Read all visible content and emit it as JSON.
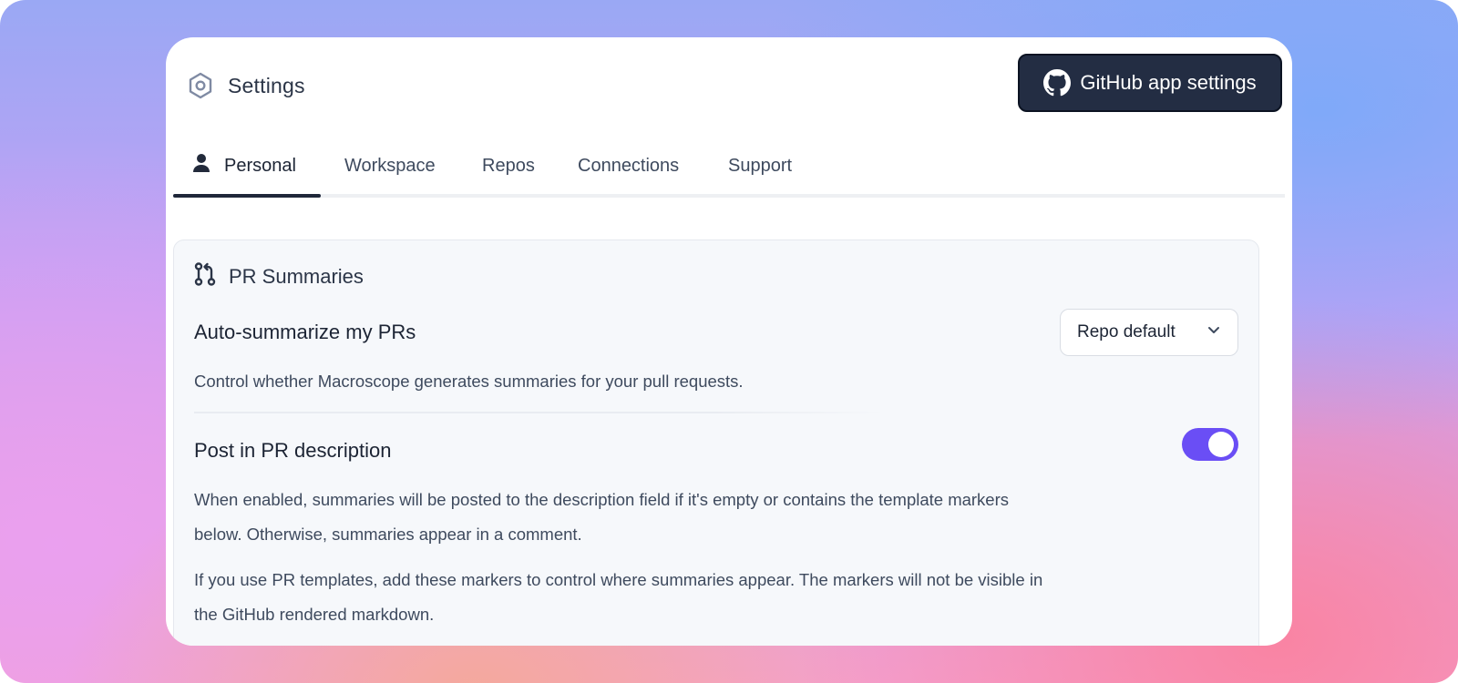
{
  "header": {
    "title": "Settings",
    "github_button_label": "GitHub app settings"
  },
  "tabs": [
    {
      "label": "Personal",
      "active": true
    },
    {
      "label": "Workspace",
      "active": false
    },
    {
      "label": "Repos",
      "active": false
    },
    {
      "label": "Connections",
      "active": false
    },
    {
      "label": "Support",
      "active": false
    }
  ],
  "pr_summaries": {
    "title": "PR Summaries",
    "auto_summarize": {
      "title": "Auto-summarize my PRs",
      "description": "Control whether Macroscope generates summaries for your pull requests.",
      "selected": "Repo default"
    },
    "post_in_description": {
      "title": "Post in PR description",
      "enabled": true,
      "description": "When enabled, summaries will be posted to the description field if it's empty or contains the template markers below. Otherwise, summaries appear in a comment.",
      "templates_note": "If you use PR templates, add these markers to control where summaries appear. The markers will not be visible in the GitHub rendered markdown."
    }
  },
  "colors": {
    "accent_toggle": "#6a4ef5",
    "button_dark": "#232d43",
    "text_primary": "#1c2434"
  },
  "icons": [
    "hexagon-settings-icon",
    "github-icon",
    "user-icon",
    "git-pull-request-icon",
    "chevron-down-icon"
  ]
}
